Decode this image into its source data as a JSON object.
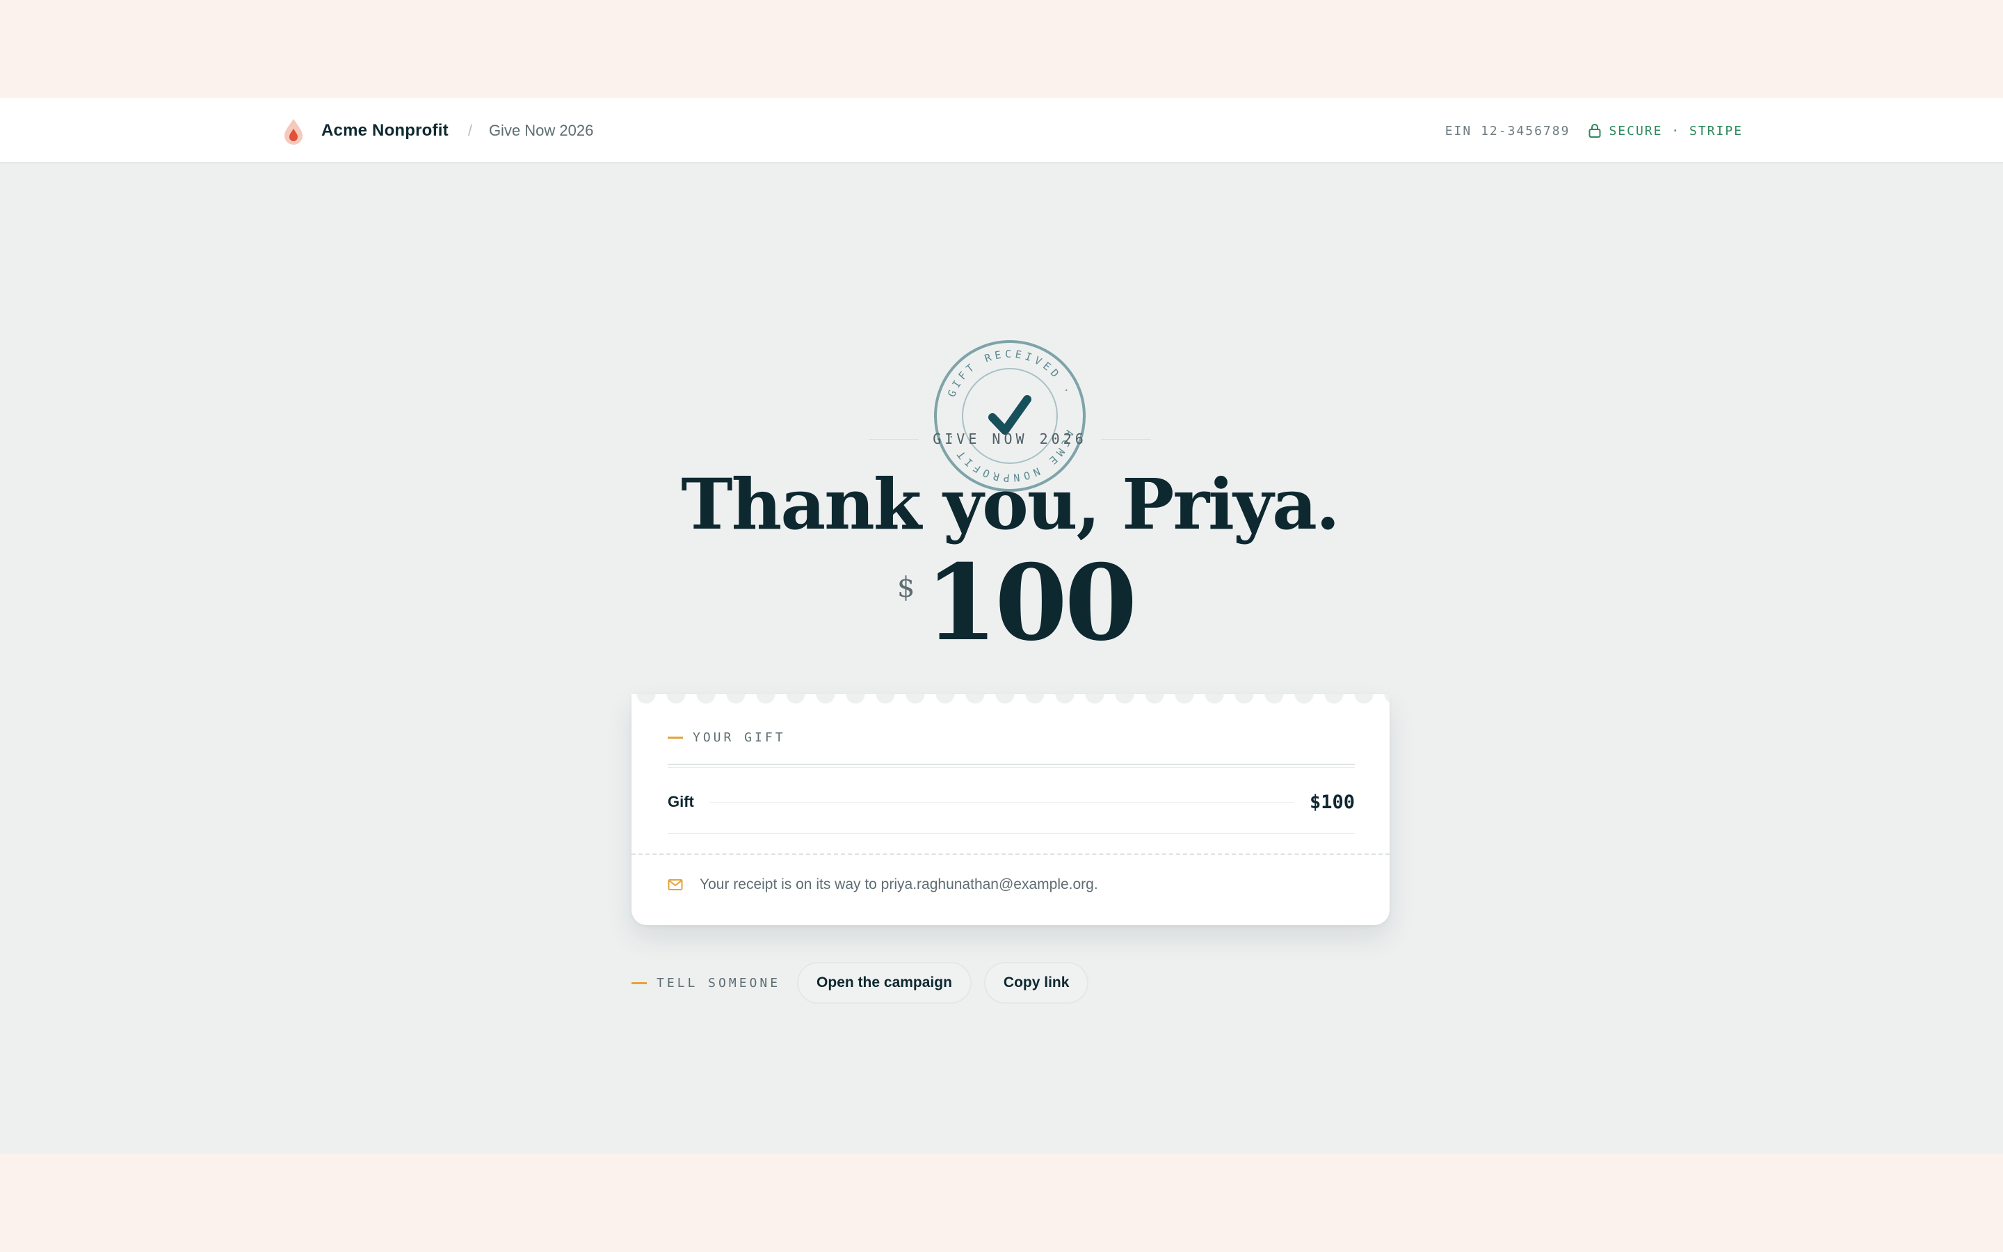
{
  "header": {
    "brand_name": "Acme Nonprofit",
    "breadcrumb_sep": "/",
    "breadcrumb": "Give Now 2026",
    "ein": "EIN 12-3456789",
    "secure": "SECURE · STRIPE"
  },
  "seal": {
    "ring_text_top": "GIFT RECEIVED ·",
    "ring_text_bottom": "ACME NONPROFIT ·",
    "icon": "check-icon"
  },
  "hero": {
    "eyebrow": "GIVE NOW 2026",
    "headline": "Thank you, Priya.",
    "currency": "$",
    "amount": "100"
  },
  "card": {
    "label": "YOUR GIFT",
    "line_items": [
      {
        "name": "Gift",
        "value": "$100"
      }
    ],
    "receipt_icon": "mail-icon",
    "receipt_text": "Your receipt is on its way to priya.raghunathan@example.org."
  },
  "share": {
    "label": "TELL SOMEONE",
    "open_campaign": "Open the campaign",
    "copy_link": "Copy link"
  },
  "colors": {
    "ink": "#0e2830",
    "accent": "#e4a33a",
    "secure_green": "#2e8a5c",
    "page_bg": "#eef0f0",
    "outer_bg": "#fcf2ed",
    "seal_teal": "#7ea3a8"
  }
}
